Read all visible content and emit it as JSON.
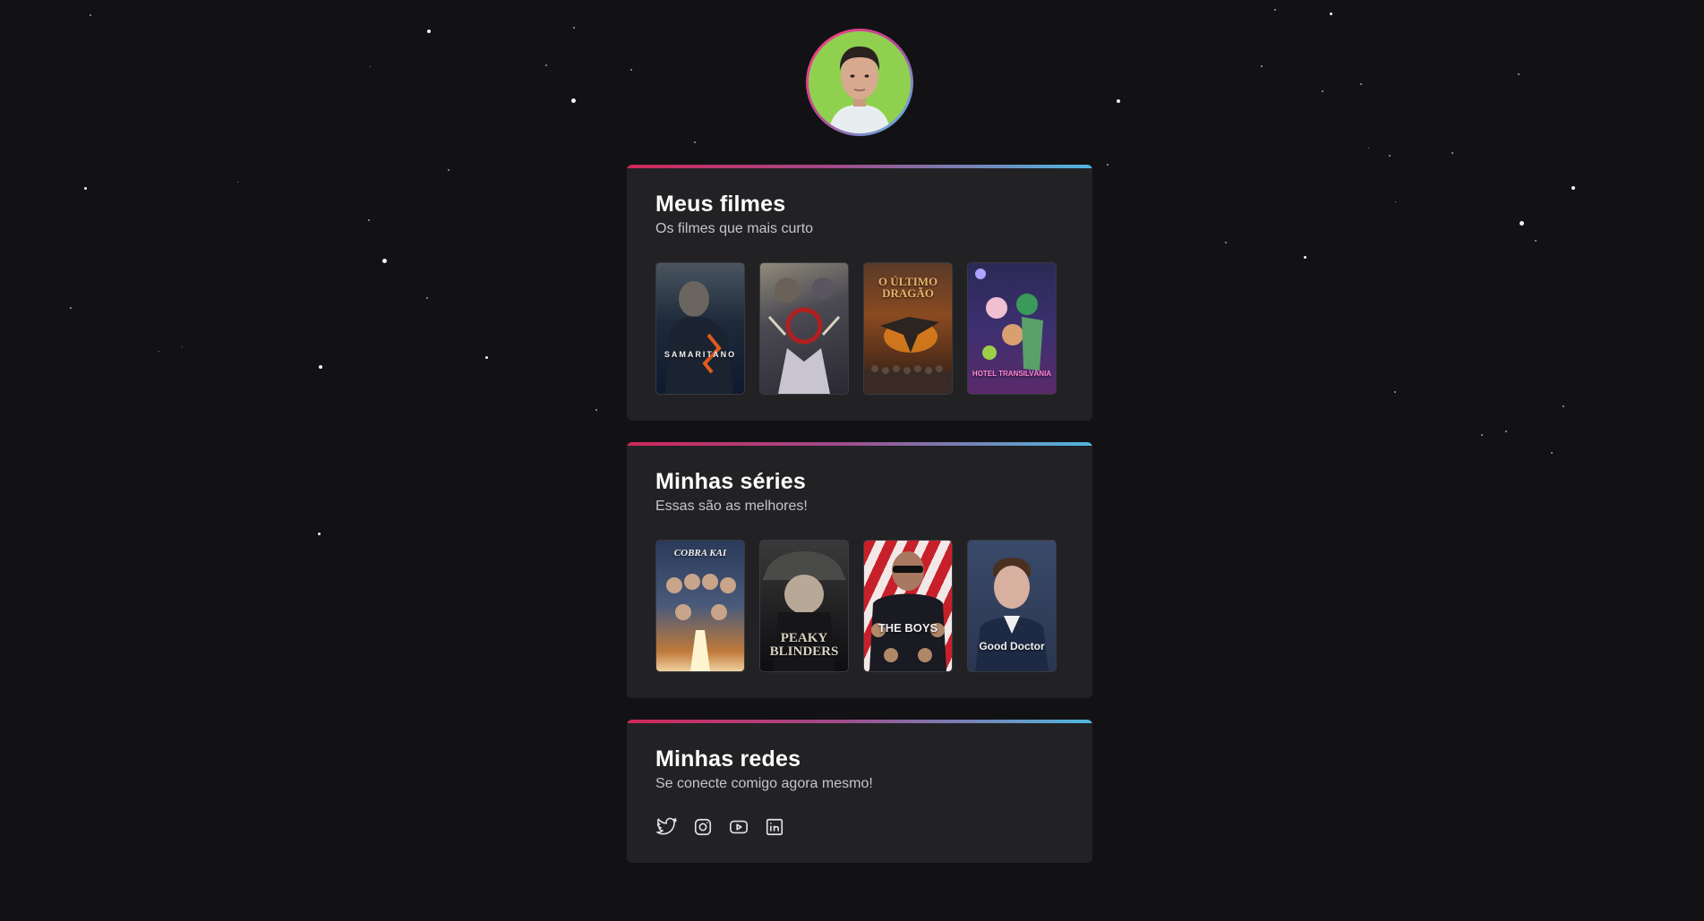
{
  "profile": {
    "avatar_alt": "Foto de perfil"
  },
  "sections": {
    "movies": {
      "title": "Meus filmes",
      "subtitle": "Os filmes que mais curto",
      "items": [
        {
          "name": "Samaritano",
          "label": "SAMARITANO"
        },
        {
          "name": "Jujutsu Kaisen 0",
          "label": ""
        },
        {
          "name": "O Último Dragão",
          "label": "O ÚLTIMO\nDRAGÃO"
        },
        {
          "name": "Hotel Transilvânia",
          "label": "HOTEL TRANSILVÂNIA"
        }
      ]
    },
    "series": {
      "title": "Minhas séries",
      "subtitle": "Essas são as melhores!",
      "items": [
        {
          "name": "Cobra Kai",
          "label": "COBRA KAI"
        },
        {
          "name": "Peaky Blinders",
          "label": "PEAKY\nBLINDERS"
        },
        {
          "name": "The Boys",
          "label": "THE BOYS"
        },
        {
          "name": "The Good Doctor",
          "label": "Good Doctor"
        }
      ]
    },
    "socials": {
      "title": "Minhas redes",
      "subtitle": "Se conecte comigo agora mesmo!",
      "icons": [
        "twitter-icon",
        "instagram-icon",
        "youtube-icon",
        "linkedin-icon"
      ]
    }
  },
  "colors": {
    "background": "#121214",
    "card": "#222225",
    "accent_start": "#d0285a",
    "accent_end": "#4fb8e0"
  }
}
